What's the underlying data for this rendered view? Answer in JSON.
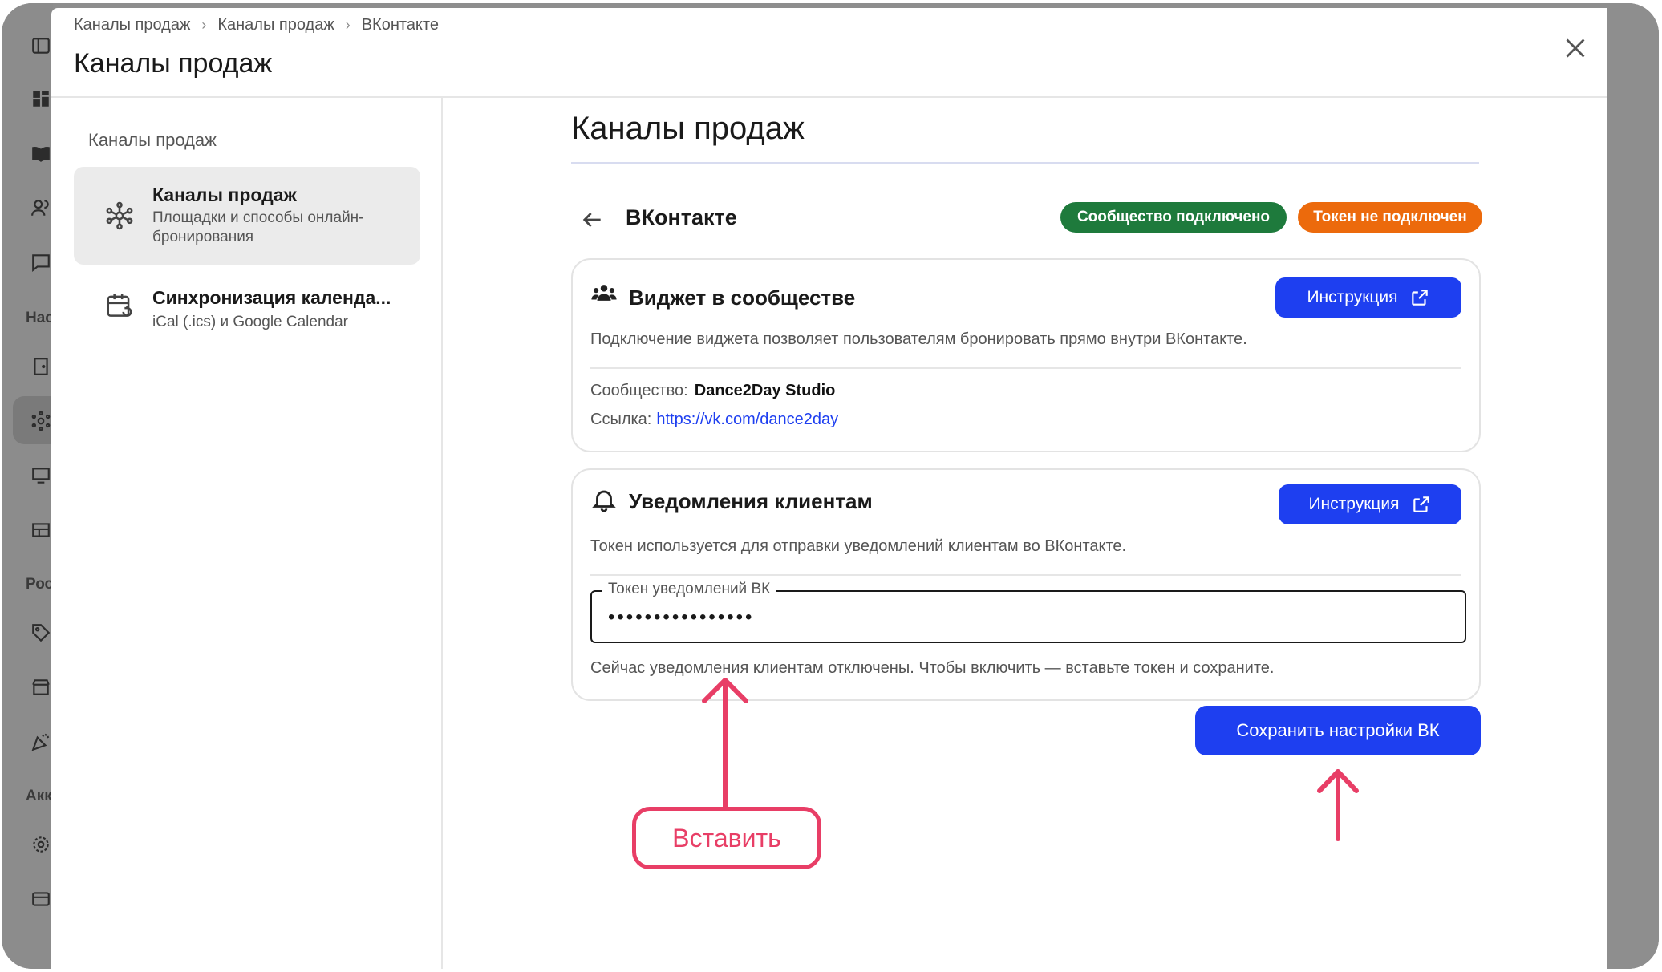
{
  "breadcrumb": [
    "Каналы продаж",
    "Каналы продаж",
    "ВКонтакте"
  ],
  "breadcrumb_separator": "›",
  "modal_title": "Каналы продаж",
  "left_nav": {
    "section_title": "Каналы продаж",
    "items": [
      {
        "title": "Каналы продаж",
        "subtitle": "Площадки и способы онлайн-бронирования",
        "icon": "network-icon",
        "active": true
      },
      {
        "title": "Синхронизация календа...",
        "subtitle": "iCal (.ics) и Google Calendar",
        "icon": "calendar-sync-icon",
        "active": false
      }
    ]
  },
  "background_sidebar": {
    "labels": [
      "Нас",
      "Рос",
      "Акк"
    ]
  },
  "content": {
    "title": "Каналы продаж",
    "section": "ВКонтакте",
    "badges": {
      "community": {
        "label": "Сообщество подключено",
        "color": "#1e7a3c"
      },
      "token": {
        "label": "Токен не подключен",
        "color": "#ec6a0c"
      }
    },
    "widget_card": {
      "title": "Виджет в сообществе",
      "instruction_label": "Инструкция",
      "description": "Подключение виджета позволяет пользователям бронировать прямо внутри ВКонтакте.",
      "community_label": "Сообщество:",
      "community_value": "Dance2Day Studio",
      "link_label": "Ссылка:",
      "link_value": "https://vk.com/dance2day"
    },
    "notify_card": {
      "title": "Уведомления клиентам",
      "instruction_label": "Инструкция",
      "description": "Токен используется для отправки уведомлений клиентам во ВКонтакте.",
      "token_label": "Токен уведомлений ВК",
      "token_value": "••••••••••••••••",
      "hint": "Сейчас уведомления клиентам отключены. Чтобы включить — вставьте токен и сохраните."
    },
    "save_label": "Сохранить настройки ВК"
  },
  "annotation": {
    "label": "Вставить",
    "color": "#e83e66"
  },
  "colors": {
    "accent": "#1e3ff0",
    "overlay": "#8e8e8e"
  }
}
